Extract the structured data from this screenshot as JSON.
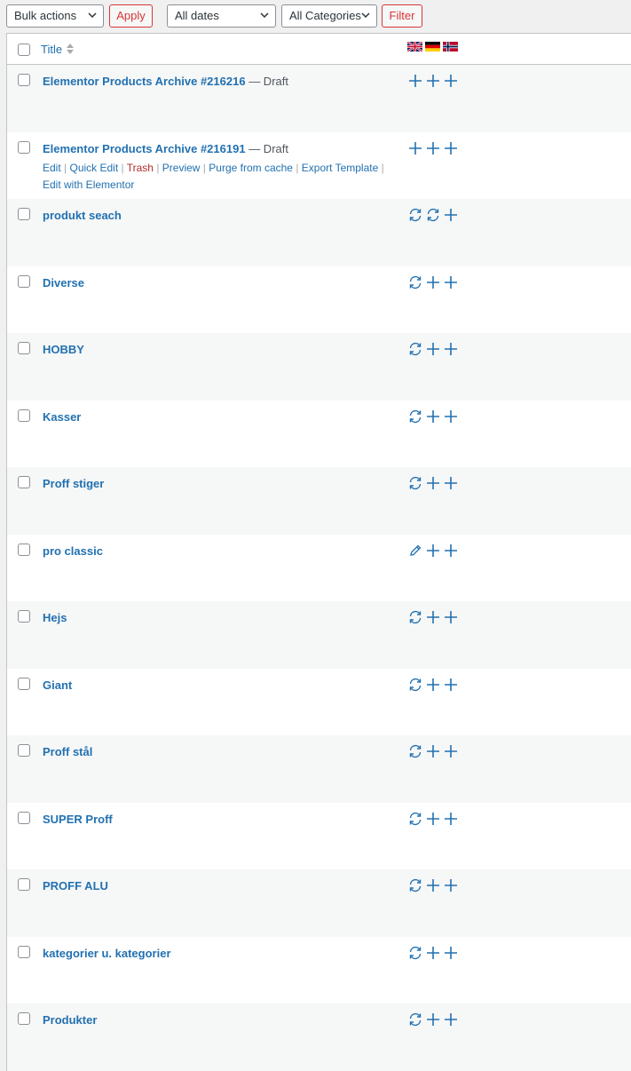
{
  "toolbar": {
    "bulk_actions": "Bulk actions",
    "apply": "Apply",
    "dates": "All dates",
    "categories": "All Categories",
    "filter": "Filter"
  },
  "table": {
    "header_title": "Title",
    "languages": [
      "en-flag",
      "de-flag",
      "no-flag"
    ],
    "rows": [
      {
        "title": "Elementor Products Archive #216216",
        "state": " — Draft",
        "langs": [
          "add",
          "add",
          "add"
        ]
      },
      {
        "title": "Elementor Products Archive #216191",
        "state": " — Draft",
        "langs": [
          "add",
          "add",
          "add"
        ],
        "actions": [
          "Edit",
          "Quick Edit",
          "Trash",
          "Preview",
          "Purge from cache",
          "Export Template",
          "Edit with Elementor"
        ]
      },
      {
        "title": "produkt seach",
        "langs": [
          "sync",
          "sync",
          "add"
        ]
      },
      {
        "title": "Diverse",
        "langs": [
          "sync",
          "add",
          "add"
        ]
      },
      {
        "title": "HOBBY",
        "langs": [
          "sync",
          "add",
          "add"
        ]
      },
      {
        "title": "Kasser",
        "langs": [
          "sync",
          "add",
          "add"
        ]
      },
      {
        "title": "Proff stiger",
        "langs": [
          "sync",
          "add",
          "add"
        ]
      },
      {
        "title": "pro classic",
        "langs": [
          "edit",
          "add",
          "add"
        ]
      },
      {
        "title": "Hejs",
        "langs": [
          "sync",
          "add",
          "add"
        ]
      },
      {
        "title": "Giant",
        "langs": [
          "sync",
          "add",
          "add"
        ]
      },
      {
        "title": "Proff stål",
        "langs": [
          "sync",
          "add",
          "add"
        ]
      },
      {
        "title": "SUPER Proff",
        "langs": [
          "sync",
          "add",
          "add"
        ]
      },
      {
        "title": "PROFF ALU",
        "langs": [
          "sync",
          "add",
          "add"
        ]
      },
      {
        "title": "kategorier u. kategorier",
        "langs": [
          "sync",
          "add",
          "add"
        ]
      },
      {
        "title": "Produkter",
        "langs": [
          "sync",
          "add",
          "add"
        ]
      }
    ]
  },
  "colors": {
    "link": "#2271b1",
    "trash": "#b32d2e",
    "filter_border": "#d63638",
    "row_alt": "#f6f7f7"
  }
}
